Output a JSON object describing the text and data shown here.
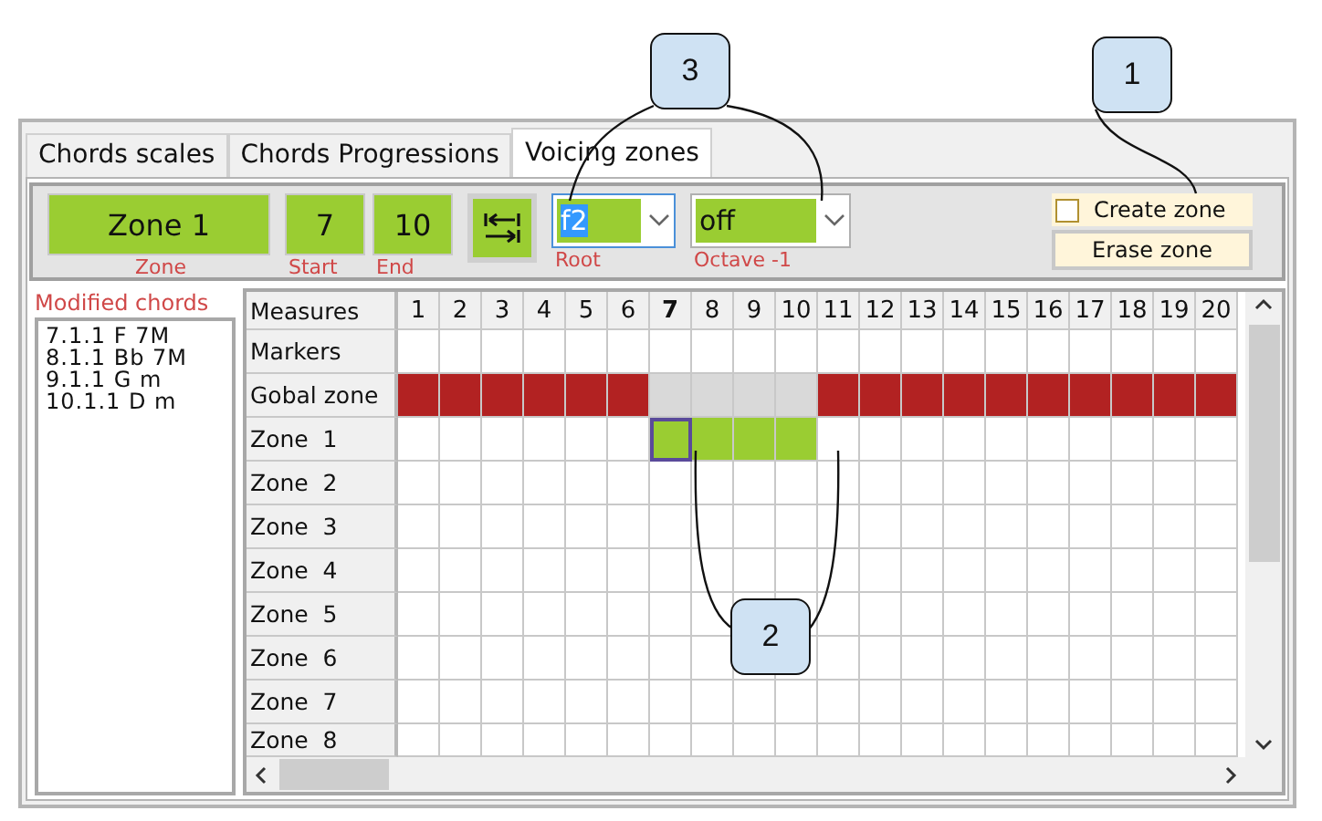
{
  "tabs": [
    {
      "label": "Chords scales",
      "selected": false
    },
    {
      "label": "Chords Progressions",
      "selected": false
    },
    {
      "label": "Voicing zones",
      "selected": true
    }
  ],
  "toolbar": {
    "zone": {
      "value": "Zone 1",
      "label": "Zone"
    },
    "start": {
      "value": "7",
      "label": "Start"
    },
    "end": {
      "value": "10",
      "label": "End"
    },
    "root": {
      "value": "f2",
      "label": "Root"
    },
    "octave": {
      "value": "off",
      "label": "Octave -1"
    },
    "create_zone": {
      "label": "Create zone",
      "checked": false
    },
    "erase_zone": {
      "label": "Erase zone"
    }
  },
  "modified_chords": {
    "title": "Modified chords",
    "items": [
      "7.1.1 F 7M",
      "8.1.1 Bb 7M",
      "9.1.1 G m",
      "10.1.1 D m"
    ]
  },
  "grid": {
    "corner": "Measures",
    "columns": [
      {
        "label": "1",
        "selected": false
      },
      {
        "label": "2",
        "selected": false
      },
      {
        "label": "3",
        "selected": false
      },
      {
        "label": "4",
        "selected": false
      },
      {
        "label": "5",
        "selected": false
      },
      {
        "label": "6",
        "selected": false
      },
      {
        "label": "7",
        "selected": true
      },
      {
        "label": "8",
        "selected": false
      },
      {
        "label": "9",
        "selected": false
      },
      {
        "label": "10",
        "selected": false
      },
      {
        "label": "11",
        "selected": false
      },
      {
        "label": "12",
        "selected": false
      },
      {
        "label": "13",
        "selected": false
      },
      {
        "label": "14",
        "selected": false
      },
      {
        "label": "15",
        "selected": false
      },
      {
        "label": "16",
        "selected": false
      },
      {
        "label": "17",
        "selected": false
      },
      {
        "label": "18",
        "selected": false
      },
      {
        "label": "19",
        "selected": false
      },
      {
        "label": "20",
        "selected": false
      }
    ],
    "rows": [
      {
        "label": "Markers",
        "cells": [
          {
            "kind": "empty"
          },
          {
            "kind": "empty"
          },
          {
            "kind": "empty"
          },
          {
            "kind": "empty"
          },
          {
            "kind": "empty"
          },
          {
            "kind": "empty"
          },
          {
            "kind": "empty"
          },
          {
            "kind": "empty"
          },
          {
            "kind": "empty"
          },
          {
            "kind": "empty"
          },
          {
            "kind": "empty"
          },
          {
            "kind": "empty"
          },
          {
            "kind": "empty"
          },
          {
            "kind": "empty"
          },
          {
            "kind": "empty"
          },
          {
            "kind": "empty"
          },
          {
            "kind": "empty"
          },
          {
            "kind": "empty"
          },
          {
            "kind": "empty"
          },
          {
            "kind": "empty"
          }
        ]
      },
      {
        "label": "Gobal zone",
        "cells": [
          {
            "kind": "global"
          },
          {
            "kind": "global"
          },
          {
            "kind": "global"
          },
          {
            "kind": "global"
          },
          {
            "kind": "global"
          },
          {
            "kind": "global"
          },
          {
            "kind": "excluded"
          },
          {
            "kind": "excluded"
          },
          {
            "kind": "excluded"
          },
          {
            "kind": "excluded"
          },
          {
            "kind": "global"
          },
          {
            "kind": "global"
          },
          {
            "kind": "global"
          },
          {
            "kind": "global"
          },
          {
            "kind": "global"
          },
          {
            "kind": "global"
          },
          {
            "kind": "global"
          },
          {
            "kind": "global"
          },
          {
            "kind": "global"
          },
          {
            "kind": "global"
          }
        ]
      },
      {
        "label": "Zone  1",
        "cells": [
          {
            "kind": "empty"
          },
          {
            "kind": "empty"
          },
          {
            "kind": "empty"
          },
          {
            "kind": "empty"
          },
          {
            "kind": "empty"
          },
          {
            "kind": "empty"
          },
          {
            "kind": "zone-selected"
          },
          {
            "kind": "zone"
          },
          {
            "kind": "zone"
          },
          {
            "kind": "zone"
          },
          {
            "kind": "empty"
          },
          {
            "kind": "empty"
          },
          {
            "kind": "empty"
          },
          {
            "kind": "empty"
          },
          {
            "kind": "empty"
          },
          {
            "kind": "empty"
          },
          {
            "kind": "empty"
          },
          {
            "kind": "empty"
          },
          {
            "kind": "empty"
          },
          {
            "kind": "empty"
          }
        ]
      },
      {
        "label": "Zone  2",
        "cells": [
          {
            "kind": "empty"
          },
          {
            "kind": "empty"
          },
          {
            "kind": "empty"
          },
          {
            "kind": "empty"
          },
          {
            "kind": "empty"
          },
          {
            "kind": "empty"
          },
          {
            "kind": "empty"
          },
          {
            "kind": "empty"
          },
          {
            "kind": "empty"
          },
          {
            "kind": "empty"
          },
          {
            "kind": "empty"
          },
          {
            "kind": "empty"
          },
          {
            "kind": "empty"
          },
          {
            "kind": "empty"
          },
          {
            "kind": "empty"
          },
          {
            "kind": "empty"
          },
          {
            "kind": "empty"
          },
          {
            "kind": "empty"
          },
          {
            "kind": "empty"
          },
          {
            "kind": "empty"
          }
        ]
      },
      {
        "label": "Zone  3",
        "cells": [
          {
            "kind": "empty"
          },
          {
            "kind": "empty"
          },
          {
            "kind": "empty"
          },
          {
            "kind": "empty"
          },
          {
            "kind": "empty"
          },
          {
            "kind": "empty"
          },
          {
            "kind": "empty"
          },
          {
            "kind": "empty"
          },
          {
            "kind": "empty"
          },
          {
            "kind": "empty"
          },
          {
            "kind": "empty"
          },
          {
            "kind": "empty"
          },
          {
            "kind": "empty"
          },
          {
            "kind": "empty"
          },
          {
            "kind": "empty"
          },
          {
            "kind": "empty"
          },
          {
            "kind": "empty"
          },
          {
            "kind": "empty"
          },
          {
            "kind": "empty"
          },
          {
            "kind": "empty"
          }
        ]
      },
      {
        "label": "Zone  4",
        "cells": [
          {
            "kind": "empty"
          },
          {
            "kind": "empty"
          },
          {
            "kind": "empty"
          },
          {
            "kind": "empty"
          },
          {
            "kind": "empty"
          },
          {
            "kind": "empty"
          },
          {
            "kind": "empty"
          },
          {
            "kind": "empty"
          },
          {
            "kind": "empty"
          },
          {
            "kind": "empty"
          },
          {
            "kind": "empty"
          },
          {
            "kind": "empty"
          },
          {
            "kind": "empty"
          },
          {
            "kind": "empty"
          },
          {
            "kind": "empty"
          },
          {
            "kind": "empty"
          },
          {
            "kind": "empty"
          },
          {
            "kind": "empty"
          },
          {
            "kind": "empty"
          },
          {
            "kind": "empty"
          }
        ]
      },
      {
        "label": "Zone  5",
        "cells": [
          {
            "kind": "empty"
          },
          {
            "kind": "empty"
          },
          {
            "kind": "empty"
          },
          {
            "kind": "empty"
          },
          {
            "kind": "empty"
          },
          {
            "kind": "empty"
          },
          {
            "kind": "empty"
          },
          {
            "kind": "empty"
          },
          {
            "kind": "empty"
          },
          {
            "kind": "empty"
          },
          {
            "kind": "empty"
          },
          {
            "kind": "empty"
          },
          {
            "kind": "empty"
          },
          {
            "kind": "empty"
          },
          {
            "kind": "empty"
          },
          {
            "kind": "empty"
          },
          {
            "kind": "empty"
          },
          {
            "kind": "empty"
          },
          {
            "kind": "empty"
          },
          {
            "kind": "empty"
          }
        ]
      },
      {
        "label": "Zone  6",
        "cells": [
          {
            "kind": "empty"
          },
          {
            "kind": "empty"
          },
          {
            "kind": "empty"
          },
          {
            "kind": "empty"
          },
          {
            "kind": "empty"
          },
          {
            "kind": "empty"
          },
          {
            "kind": "empty"
          },
          {
            "kind": "empty"
          },
          {
            "kind": "empty"
          },
          {
            "kind": "empty"
          },
          {
            "kind": "empty"
          },
          {
            "kind": "empty"
          },
          {
            "kind": "empty"
          },
          {
            "kind": "empty"
          },
          {
            "kind": "empty"
          },
          {
            "kind": "empty"
          },
          {
            "kind": "empty"
          },
          {
            "kind": "empty"
          },
          {
            "kind": "empty"
          },
          {
            "kind": "empty"
          }
        ]
      },
      {
        "label": "Zone  7",
        "cells": [
          {
            "kind": "empty"
          },
          {
            "kind": "empty"
          },
          {
            "kind": "empty"
          },
          {
            "kind": "empty"
          },
          {
            "kind": "empty"
          },
          {
            "kind": "empty"
          },
          {
            "kind": "empty"
          },
          {
            "kind": "empty"
          },
          {
            "kind": "empty"
          },
          {
            "kind": "empty"
          },
          {
            "kind": "empty"
          },
          {
            "kind": "empty"
          },
          {
            "kind": "empty"
          },
          {
            "kind": "empty"
          },
          {
            "kind": "empty"
          },
          {
            "kind": "empty"
          },
          {
            "kind": "empty"
          },
          {
            "kind": "empty"
          },
          {
            "kind": "empty"
          },
          {
            "kind": "empty"
          }
        ]
      },
      {
        "label": "Zone  8",
        "cells": [
          {
            "kind": "empty"
          },
          {
            "kind": "empty"
          },
          {
            "kind": "empty"
          },
          {
            "kind": "empty"
          },
          {
            "kind": "empty"
          },
          {
            "kind": "empty"
          },
          {
            "kind": "empty"
          },
          {
            "kind": "empty"
          },
          {
            "kind": "empty"
          },
          {
            "kind": "empty"
          },
          {
            "kind": "empty"
          },
          {
            "kind": "empty"
          },
          {
            "kind": "empty"
          },
          {
            "kind": "empty"
          },
          {
            "kind": "empty"
          },
          {
            "kind": "empty"
          },
          {
            "kind": "empty"
          },
          {
            "kind": "empty"
          },
          {
            "kind": "empty"
          },
          {
            "kind": "empty"
          }
        ]
      }
    ]
  },
  "callouts": [
    {
      "label": "3"
    },
    {
      "label": "1"
    },
    {
      "label": "2"
    }
  ]
}
